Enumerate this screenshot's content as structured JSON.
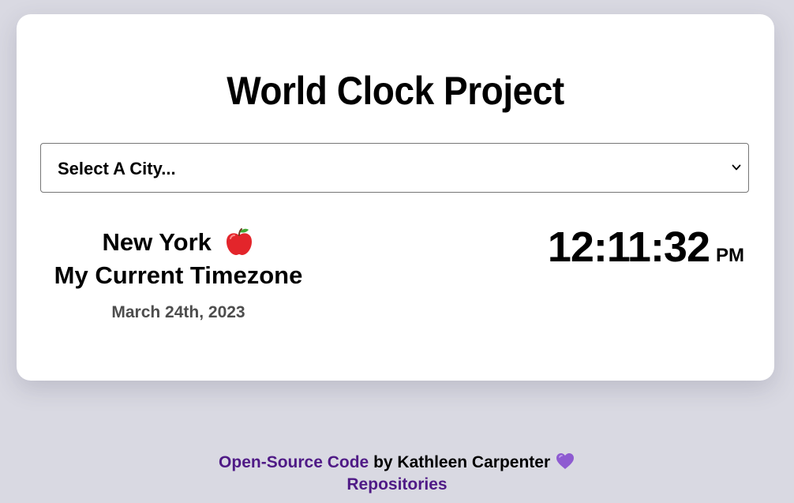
{
  "page": {
    "title": "World Clock Project"
  },
  "select": {
    "label": "Select A City...",
    "chevron_icon": "chevron-down-icon"
  },
  "city": {
    "name": "New York",
    "emoji_icon": "red-apple-icon",
    "subtitle": "My Current Timezone",
    "date": "March 24th, 2023",
    "time": "12:11:32",
    "ampm": "PM"
  },
  "footer": {
    "source_link": "Open-Source Code",
    "by_text": " by Kathleen Carpenter ",
    "heart_icon": "purple-heart-icon",
    "repositories_link": "Repositories"
  },
  "colors": {
    "background": "#d9d9e2",
    "card": "#ffffff",
    "link": "#4f1a86",
    "date": "#4d4d4d",
    "heart": "#8e5bd1"
  }
}
